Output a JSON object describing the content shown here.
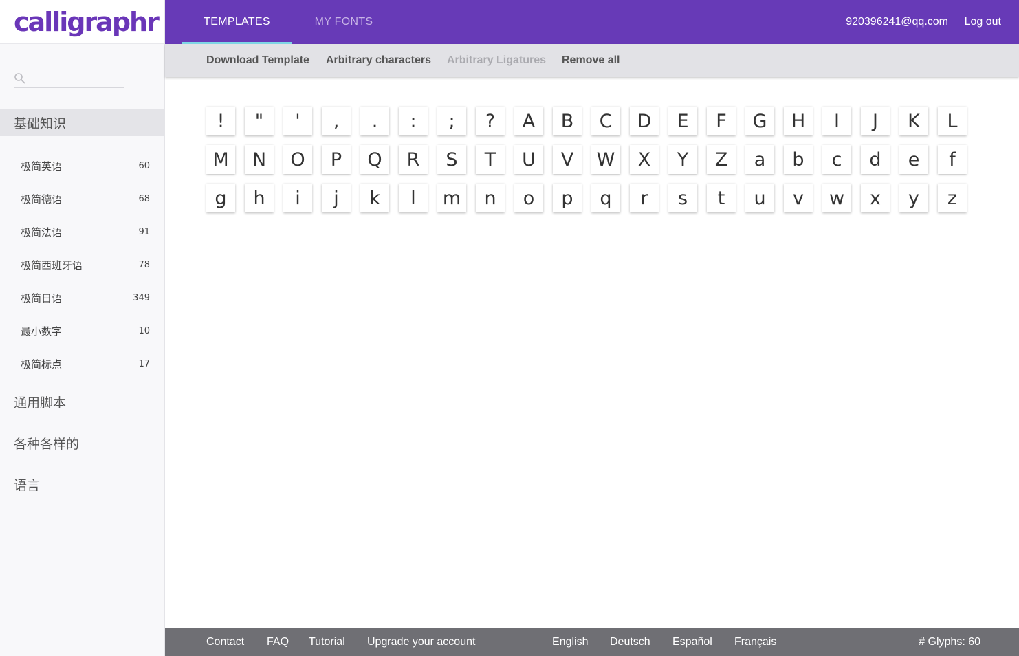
{
  "brand": {
    "logo_text": "calligraphr"
  },
  "search": {
    "placeholder": ""
  },
  "sidebar": {
    "sections": [
      {
        "label": "基础知识",
        "active": true
      },
      {
        "label": "通用脚本"
      },
      {
        "label": "各种各样的"
      },
      {
        "label": "语言"
      }
    ],
    "items": [
      {
        "label": "极简英语",
        "count": "60"
      },
      {
        "label": "极简德语",
        "count": "68"
      },
      {
        "label": "极简法语",
        "count": "91"
      },
      {
        "label": "极简西班牙语",
        "count": "78"
      },
      {
        "label": "极简日语",
        "count": "349"
      },
      {
        "label": "最小数字",
        "count": "10"
      },
      {
        "label": "极简标点",
        "count": "17"
      }
    ]
  },
  "topbar": {
    "tabs": [
      {
        "label": "TEMPLATES"
      },
      {
        "label": "MY FONTS"
      }
    ],
    "user_email": "920396241@qq.com",
    "logout": "Log out"
  },
  "subbar": {
    "download": "Download Template",
    "arbitrary_characters": "Arbitrary characters",
    "arbitrary_ligatures": "Arbitrary Ligatures",
    "remove_all": "Remove all"
  },
  "glyphs": [
    [
      "!",
      "\"",
      "'",
      ",",
      ".",
      ":",
      ";",
      "?",
      "A",
      "B",
      "C",
      "D",
      "E",
      "F",
      "G",
      "H",
      "I",
      "J",
      "K",
      "L"
    ],
    [
      "M",
      "N",
      "O",
      "P",
      "Q",
      "R",
      "S",
      "T",
      "U",
      "V",
      "W",
      "X",
      "Y",
      "Z",
      "a",
      "b",
      "c",
      "d",
      "e",
      "f"
    ],
    [
      "g",
      "h",
      "i",
      "j",
      "k",
      "l",
      "m",
      "n",
      "o",
      "p",
      "q",
      "r",
      "s",
      "t",
      "u",
      "v",
      "w",
      "x",
      "y",
      "z"
    ]
  ],
  "footer": {
    "contact": "Contact",
    "faq": "FAQ",
    "tutorial": "Tutorial",
    "upgrade": "Upgrade your account",
    "lang_en": "English",
    "lang_de": "Deutsch",
    "lang_es": "Español",
    "lang_fr": "Français",
    "glyph_count": "# Glyphs: 60"
  },
  "colors": {
    "topbar": "#673ab7",
    "tab_indicator": "#7fd7e6",
    "subbar": "#e2e2e6",
    "footer": "#6f6f74"
  },
  "icons": {
    "search": "search-icon"
  }
}
